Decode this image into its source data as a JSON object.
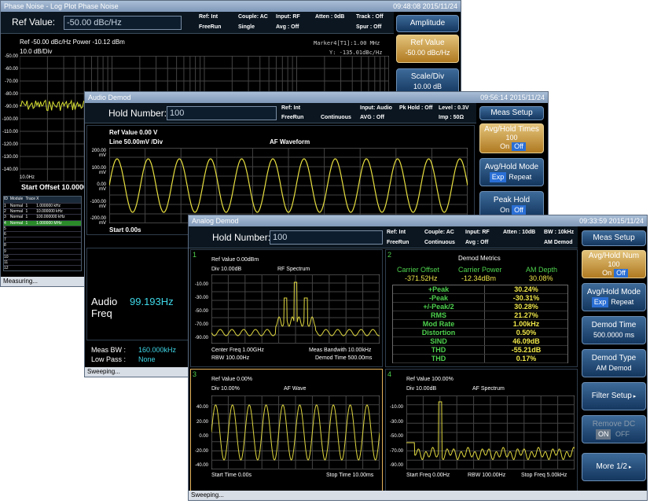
{
  "w1": {
    "title": "Phase Noise - Log Plot Phase Noise",
    "time": "09:48:08  2015/11/24",
    "ref_label": "Ref Value:",
    "ref_value": "-50.00 dBc/Hz",
    "status": [
      [
        "Ref: Int",
        "Couple: AC",
        "Input: RF",
        "Atten : 0dB",
        "Track : Off"
      ],
      [
        "FreeRun",
        "Single",
        "Avg : Off",
        "",
        "Spur : Off"
      ]
    ],
    "softkeys": [
      {
        "label": "Amplitude"
      },
      {
        "label": "Ref Value",
        "value": "-50.00 dBc/Hz"
      },
      {
        "label": "Scale/Div",
        "value": "10.00 dB"
      }
    ],
    "trace_info": "Ref -50.00 dBc/Hz   Power -10.12 dBm",
    "div": "10.0 dB/Div",
    "marker": "Marker4[T1]:1.00 MHz",
    "marker_y": "Y:  -135.01dBc/Hz",
    "ylabels": [
      "-50.00",
      "-60.00",
      "-70.00",
      "-80.00",
      "-90.00",
      "-100.00",
      "-110.00",
      "-120.00",
      "-130.00",
      "-140.00"
    ],
    "xstart": "10.0Hz",
    "start_offset": "Start Offset 10.000000",
    "table_headers": [
      "ID",
      "Module",
      "Trace",
      "X"
    ],
    "table_rows": [
      [
        "1",
        "Normal",
        "1",
        "1.000000 kHz"
      ],
      [
        "2",
        "Normal",
        "1",
        "10.000000 kHz"
      ],
      [
        "3",
        "Normal",
        "1",
        "100.000000 kHz"
      ],
      [
        "4",
        "Normal",
        "1",
        "1.000000 MHz"
      ],
      [
        "5",
        "",
        "",
        ""
      ],
      [
        "6",
        "",
        "",
        ""
      ],
      [
        "7",
        "",
        "",
        ""
      ],
      [
        "8",
        "",
        "",
        ""
      ],
      [
        "9",
        "",
        "",
        ""
      ],
      [
        "10",
        "",
        "",
        ""
      ],
      [
        "11",
        "",
        "",
        ""
      ],
      [
        "12",
        "",
        "",
        ""
      ]
    ],
    "footer": "Measuring..."
  },
  "w2": {
    "title": "Audio Demod",
    "time": "09:56:14  2015/11/24",
    "hold_label": "Hold Number:",
    "hold_value": "100",
    "status": [
      [
        "Ref: Int",
        "",
        "Input: Audio",
        "Pk Hold : Off",
        "Level : 0.3V"
      ],
      [
        "FreeRun",
        "Continuous",
        "AVG : Off",
        "",
        "Imp : 50Ω"
      ]
    ],
    "softkeys": [
      {
        "label": "Meas Setup"
      },
      {
        "label": "Avg/Hold Times",
        "value": "100",
        "on": "On",
        "off": "Off"
      },
      {
        "label": "Avg/Hold Mode",
        "on": "Exp",
        "off": "Repeat"
      },
      {
        "label": "Peak Hold",
        "on": "On",
        "off": "Off"
      }
    ],
    "ref": "Ref Value 0.00 V",
    "line": "Line 50.00mV /Div",
    "plot_title": "AF Waveform",
    "ylabels": [
      "200.00 mV",
      "100.00 mV",
      "0.00 mV",
      "-100.00 mV",
      "-200.00 mV"
    ],
    "start": "Start 0.00s",
    "audio_label": "Audio Freq",
    "audio_value": "99.193Hz",
    "meas_bw_label": "Meas BW :",
    "meas_bw": "160.000kHz",
    "low_pass_label": "Low Pass :",
    "low_pass": "None",
    "footer": "Sweeping..."
  },
  "w3": {
    "title": "Analog Demod",
    "time": "09:33:59  2015/11/24",
    "hold_label": "Hold Number:",
    "hold_value": "100",
    "status": [
      [
        "Ref: Int",
        "Couple: AC",
        "Input: RF",
        "Atten : 10dB",
        "BW : 10kHz"
      ],
      [
        "FreeRun",
        "Continuous",
        "Avg : Off",
        "",
        "AM Demod"
      ]
    ],
    "softkeys": [
      {
        "label": "Meas Setup"
      },
      {
        "label": "Avg/Hold Num",
        "value": "100",
        "on": "On",
        "off": "Off"
      },
      {
        "label": "Avg/Hold Mode",
        "on": "Exp",
        "off": "Repeat"
      },
      {
        "label": "Demod Time",
        "value": "500.0000 ms"
      },
      {
        "label": "Demod Type",
        "value": "AM Demod"
      },
      {
        "label": "Filter Setup"
      },
      {
        "label": "Remove DC",
        "on": "ON",
        "off": "OFF"
      },
      {
        "label": "More 1/2"
      }
    ],
    "p1": {
      "num": "1",
      "ref": "Ref Value 0.00dBm",
      "div": "Div 10.00dB",
      "title": "RF Spectrum",
      "ylabels": [
        "-10.00",
        "-30.00",
        "-50.00",
        "-70.00",
        "-90.00"
      ],
      "b1": "Center Freq 1.00GHz",
      "b2": "Meas Bandwith 10.00kHz",
      "b3": "RBW 100.00Hz",
      "b4": "Demod Time 500.00ms"
    },
    "p2": {
      "num": "2",
      "title": "Demod Metrics",
      "h": [
        "Carrier Offset",
        "Carrier Power",
        "AM Depth"
      ],
      "hv": [
        "-371.52Hz",
        "-12.34dBm",
        "30.08%"
      ],
      "rows": [
        [
          "+Peak",
          "30.24%"
        ],
        [
          "-Peak",
          "-30.31%"
        ],
        [
          "+/-Peak/2",
          "30.28%"
        ],
        [
          "RMS",
          "21.27%"
        ],
        [
          "Mod Rate",
          "1.00kHz"
        ],
        [
          "Distortion",
          "0.50%"
        ],
        [
          "SIND",
          "46.09dB"
        ],
        [
          "THD",
          "-55.21dB"
        ],
        [
          "THD",
          "0.17%"
        ]
      ]
    },
    "p3": {
      "num": "3",
      "ref": "Ref Value 0.00%",
      "div": "Div 10.00%",
      "title": "AF Wave",
      "ylabels": [
        "40.00",
        "20.00",
        "0.00",
        "-20.00",
        "-40.00"
      ],
      "b1": "Start Time 0.00s",
      "b2": "Stop Time 10.00ms"
    },
    "p4": {
      "num": "4",
      "ref": "Ref Value 100.00%",
      "div": "Div 10.00dB",
      "title": "AF Spectrum",
      "ylabels": [
        "-10.00",
        "-30.00",
        "-50.00",
        "-70.00",
        "-90.00"
      ],
      "b1": "Start Freq 0.00Hz",
      "b2": "RBW 100.00Hz",
      "b3": "Stop Freq 5.00kHz"
    },
    "footer": "Sweeping..."
  }
}
